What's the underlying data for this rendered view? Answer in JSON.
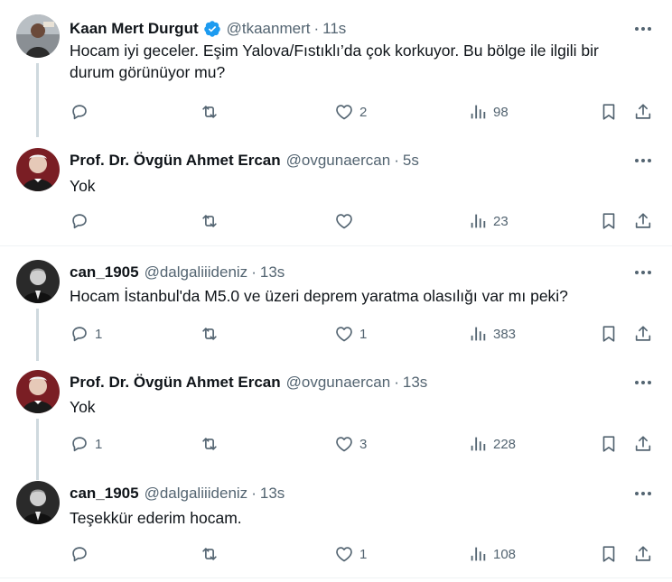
{
  "colors": {
    "text": "#0f1419",
    "muted": "#536471",
    "line": "#cfd9de",
    "verified": "#1d9bf0"
  },
  "tweets": [
    {
      "name": "Kaan Mert Durgut",
      "verified": true,
      "handle": "@tkaanmert",
      "time": "11s",
      "text_lines": [
        "Hocam iyi geceler. Eşim Yalova/Fıstıklı’da çok korkuyor. Bu bölge ile ilgili bir",
        "durum görünüyor mu?"
      ],
      "replies": "",
      "retweets": "",
      "likes": "2",
      "views": "98"
    },
    {
      "name": "Prof. Dr. Övgün Ahmet Ercan",
      "verified": false,
      "handle": "@ovgunaercan",
      "time": "5s",
      "text_lines": [
        "Yok"
      ],
      "replies": "",
      "retweets": "",
      "likes": "",
      "views": "23"
    },
    {
      "name": "can_1905",
      "verified": false,
      "handle": "@dalgaliiideniz",
      "time": "13s",
      "text_lines": [
        "Hocam İstanbul'da M5.0 ve üzeri deprem yaratma olasılığı var mı peki?"
      ],
      "replies": "1",
      "retweets": "",
      "likes": "1",
      "views": "383"
    },
    {
      "name": "Prof. Dr. Övgün Ahmet Ercan",
      "verified": false,
      "handle": "@ovgunaercan",
      "time": "13s",
      "text_lines": [
        "Yok"
      ],
      "replies": "1",
      "retweets": "",
      "likes": "3",
      "views": "228"
    },
    {
      "name": "can_1905",
      "verified": false,
      "handle": "@dalgaliiideniz",
      "time": "13s",
      "text_lines": [
        "Teşekkür ederim hocam."
      ],
      "replies": "",
      "retweets": "",
      "likes": "1",
      "views": "108"
    }
  ]
}
